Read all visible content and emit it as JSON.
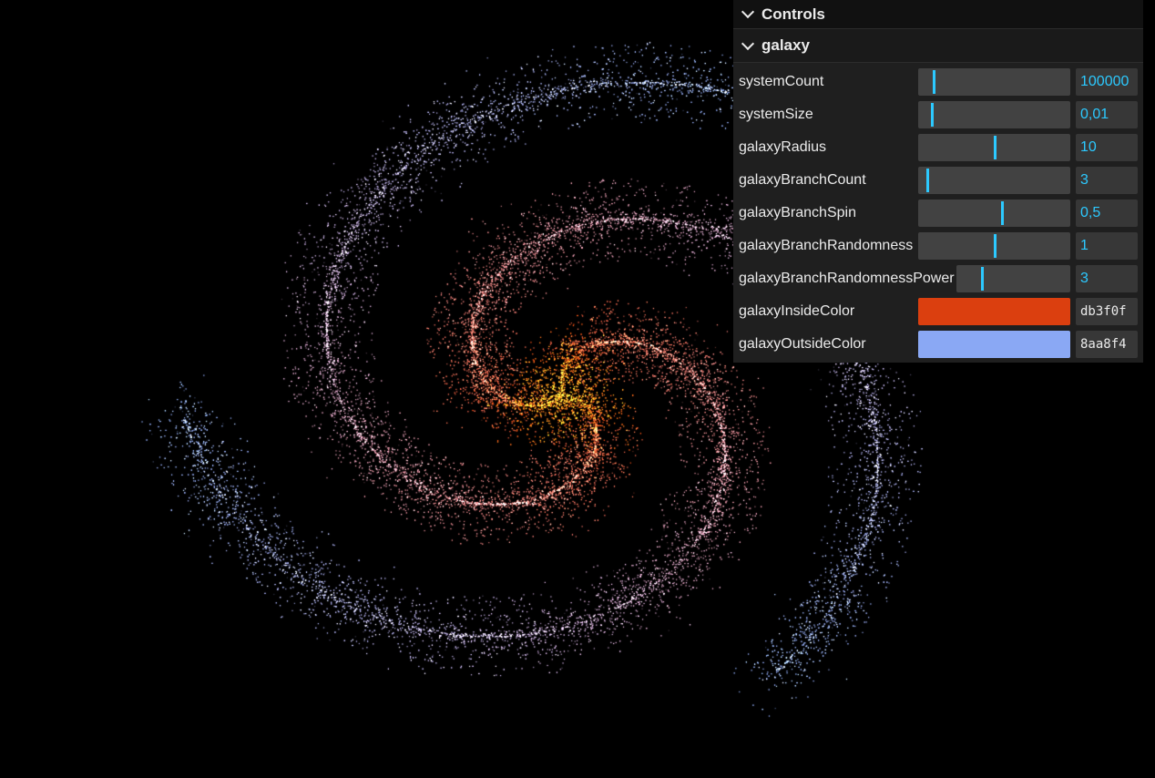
{
  "gui": {
    "title": "Controls",
    "folder": "galaxy",
    "sliders": [
      {
        "label": "systemCount",
        "value": "100000",
        "fraction": 0.1
      },
      {
        "label": "systemSize",
        "value": "0,01",
        "fraction": 0.09
      },
      {
        "label": "galaxyRadius",
        "value": "10",
        "fraction": 0.5
      },
      {
        "label": "galaxyBranchCount",
        "value": "3",
        "fraction": 0.06
      },
      {
        "label": "galaxyBranchSpin",
        "value": "0,5",
        "fraction": 0.55
      },
      {
        "label": "galaxyBranchRandomness",
        "value": "1",
        "fraction": 0.5
      },
      {
        "label": "galaxyBranchRandomnessPower",
        "value": "3",
        "fraction": 0.22
      }
    ],
    "colors": [
      {
        "label": "galaxyInsideColor",
        "hex": "db3f0f",
        "color": "#db3f0f"
      },
      {
        "label": "galaxyOutsideColor",
        "hex": "8aa8f4",
        "color": "#8aa8f4"
      }
    ]
  },
  "icons": {
    "controls_toggle": "chevron-down-icon",
    "folder_toggle": "chevron-down-icon"
  },
  "theme": {
    "background": "#000000",
    "accent": "#2cc9ff",
    "core": "#ffa01e"
  }
}
